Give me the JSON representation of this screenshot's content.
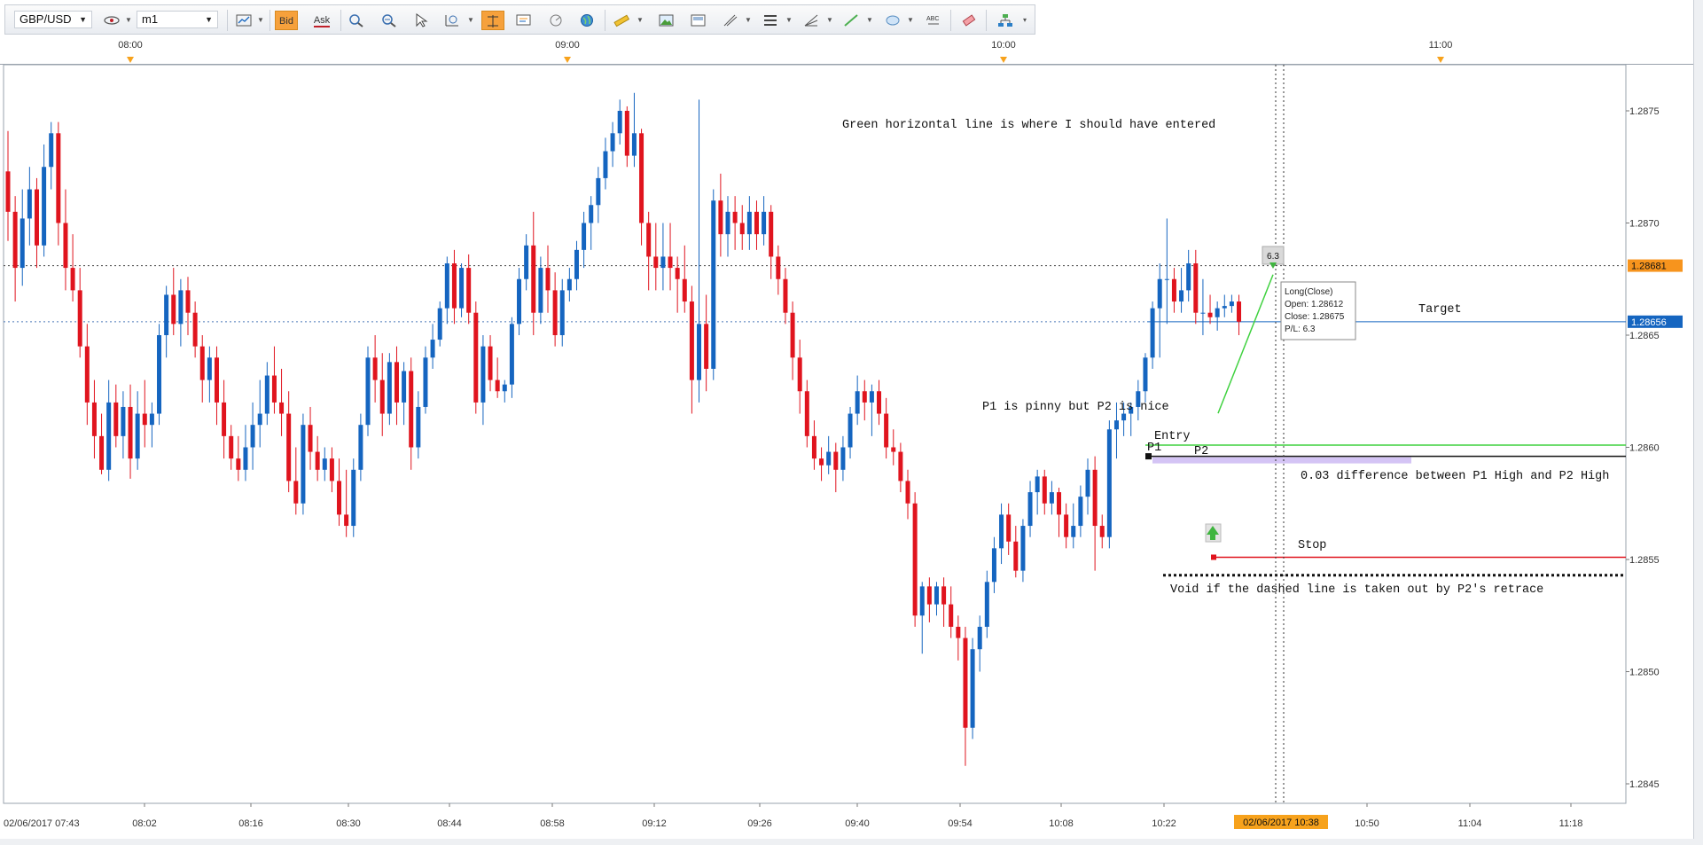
{
  "toolbar": {
    "symbol": "GBP/USD",
    "timeframe": "m1",
    "bid_label": "Bid",
    "ask_label": "Ask"
  },
  "chart_data": {
    "type": "candlestick",
    "symbol": "GBP/USD",
    "timeframe": "m1",
    "time_axis_top": [
      "08:00",
      "09:00",
      "10:00",
      "11:00"
    ],
    "time_axis_bottom": [
      "02/06/2017 07:43",
      "08:02",
      "08:16",
      "08:30",
      "08:44",
      "08:58",
      "09:12",
      "09:26",
      "09:40",
      "09:54",
      "10:08",
      "10:22",
      "10:50",
      "11:04",
      "11:18"
    ],
    "crosshair_time_label": "02/06/2017 10:38",
    "price_ticks": [
      "1.2845",
      "1.2850",
      "1.2855",
      "1.2860",
      "1.2865",
      "1.2870",
      "1.2875"
    ],
    "ylim": [
      1.28435,
      1.2878
    ],
    "price_labels": [
      {
        "value": "1.28681",
        "color": "#f7941d"
      },
      {
        "value": "1.28656",
        "color": "#1565c0"
      }
    ],
    "grid": true,
    "up_color": "#1565c0",
    "down_color": "#e0141e",
    "candles": [
      {
        "o": 1.28723,
        "h": 1.28741,
        "l": 1.28692,
        "c": 1.28705
      },
      {
        "o": 1.28705,
        "h": 1.28712,
        "l": 1.28665,
        "c": 1.2868
      },
      {
        "o": 1.2868,
        "h": 1.28715,
        "l": 1.28672,
        "c": 1.28702
      },
      {
        "o": 1.28702,
        "h": 1.28725,
        "l": 1.2869,
        "c": 1.28715
      },
      {
        "o": 1.28715,
        "h": 1.2872,
        "l": 1.2868,
        "c": 1.2869
      },
      {
        "o": 1.2869,
        "h": 1.28735,
        "l": 1.28685,
        "c": 1.28725
      },
      {
        "o": 1.28725,
        "h": 1.28745,
        "l": 1.28715,
        "c": 1.2874
      },
      {
        "o": 1.2874,
        "h": 1.28745,
        "l": 1.2869,
        "c": 1.287
      },
      {
        "o": 1.287,
        "h": 1.28715,
        "l": 1.2867,
        "c": 1.2868
      },
      {
        "o": 1.2868,
        "h": 1.28695,
        "l": 1.28665,
        "c": 1.2867
      },
      {
        "o": 1.2867,
        "h": 1.2868,
        "l": 1.2864,
        "c": 1.28645
      },
      {
        "o": 1.28645,
        "h": 1.28655,
        "l": 1.2861,
        "c": 1.2862
      },
      {
        "o": 1.2862,
        "h": 1.2863,
        "l": 1.28595,
        "c": 1.28605
      },
      {
        "o": 1.28605,
        "h": 1.28615,
        "l": 1.28588,
        "c": 1.2859
      },
      {
        "o": 1.2859,
        "h": 1.2863,
        "l": 1.28585,
        "c": 1.2862
      },
      {
        "o": 1.2862,
        "h": 1.28628,
        "l": 1.286,
        "c": 1.28605
      },
      {
        "o": 1.28605,
        "h": 1.28625,
        "l": 1.28595,
        "c": 1.28618
      },
      {
        "o": 1.28618,
        "h": 1.28628,
        "l": 1.28586,
        "c": 1.28595
      },
      {
        "o": 1.28595,
        "h": 1.28625,
        "l": 1.2859,
        "c": 1.28615
      },
      {
        "o": 1.28615,
        "h": 1.2863,
        "l": 1.286,
        "c": 1.2861
      },
      {
        "o": 1.2861,
        "h": 1.2862,
        "l": 1.286,
        "c": 1.28615
      },
      {
        "o": 1.28615,
        "h": 1.28655,
        "l": 1.2861,
        "c": 1.2865
      },
      {
        "o": 1.2865,
        "h": 1.28672,
        "l": 1.2864,
        "c": 1.28668
      },
      {
        "o": 1.28668,
        "h": 1.2868,
        "l": 1.2865,
        "c": 1.28655
      },
      {
        "o": 1.28655,
        "h": 1.28675,
        "l": 1.28645,
        "c": 1.2867
      },
      {
        "o": 1.2867,
        "h": 1.28676,
        "l": 1.2865,
        "c": 1.2866
      },
      {
        "o": 1.2866,
        "h": 1.28665,
        "l": 1.2864,
        "c": 1.28645
      },
      {
        "o": 1.28645,
        "h": 1.2865,
        "l": 1.2862,
        "c": 1.2863
      },
      {
        "o": 1.2863,
        "h": 1.28645,
        "l": 1.2862,
        "c": 1.2864
      },
      {
        "o": 1.2864,
        "h": 1.28645,
        "l": 1.2861,
        "c": 1.2862
      },
      {
        "o": 1.2862,
        "h": 1.2863,
        "l": 1.28595,
        "c": 1.28605
      },
      {
        "o": 1.28605,
        "h": 1.2861,
        "l": 1.2859,
        "c": 1.28595
      },
      {
        "o": 1.28595,
        "h": 1.28605,
        "l": 1.28585,
        "c": 1.2859
      },
      {
        "o": 1.2859,
        "h": 1.2861,
        "l": 1.28585,
        "c": 1.286
      },
      {
        "o": 1.286,
        "h": 1.2862,
        "l": 1.2859,
        "c": 1.2861
      },
      {
        "o": 1.2861,
        "h": 1.2863,
        "l": 1.286,
        "c": 1.28615
      },
      {
        "o": 1.28615,
        "h": 1.28638,
        "l": 1.2861,
        "c": 1.28632
      },
      {
        "o": 1.28632,
        "h": 1.28645,
        "l": 1.28615,
        "c": 1.2862
      },
      {
        "o": 1.2862,
        "h": 1.28635,
        "l": 1.28605,
        "c": 1.28615
      },
      {
        "o": 1.28615,
        "h": 1.28625,
        "l": 1.2858,
        "c": 1.28585
      },
      {
        "o": 1.28585,
        "h": 1.286,
        "l": 1.2857,
        "c": 1.28575
      },
      {
        "o": 1.28575,
        "h": 1.28615,
        "l": 1.2857,
        "c": 1.2861
      },
      {
        "o": 1.2861,
        "h": 1.28618,
        "l": 1.2859,
        "c": 1.28598
      },
      {
        "o": 1.28598,
        "h": 1.28605,
        "l": 1.28585,
        "c": 1.2859
      },
      {
        "o": 1.2859,
        "h": 1.286,
        "l": 1.28585,
        "c": 1.28595
      },
      {
        "o": 1.28595,
        "h": 1.286,
        "l": 1.2858,
        "c": 1.28585
      },
      {
        "o": 1.28585,
        "h": 1.28595,
        "l": 1.28565,
        "c": 1.2857
      },
      {
        "o": 1.2857,
        "h": 1.2859,
        "l": 1.2856,
        "c": 1.28565
      },
      {
        "o": 1.28565,
        "h": 1.28595,
        "l": 1.2856,
        "c": 1.2859
      },
      {
        "o": 1.2859,
        "h": 1.28615,
        "l": 1.28585,
        "c": 1.2861
      },
      {
        "o": 1.2861,
        "h": 1.28645,
        "l": 1.28605,
        "c": 1.2864
      },
      {
        "o": 1.2864,
        "h": 1.2865,
        "l": 1.2862,
        "c": 1.2863
      },
      {
        "o": 1.2863,
        "h": 1.28642,
        "l": 1.28605,
        "c": 1.28615
      },
      {
        "o": 1.28615,
        "h": 1.28642,
        "l": 1.2861,
        "c": 1.28638
      },
      {
        "o": 1.28638,
        "h": 1.28645,
        "l": 1.2861,
        "c": 1.2862
      },
      {
        "o": 1.2862,
        "h": 1.28638,
        "l": 1.2861,
        "c": 1.28634
      },
      {
        "o": 1.28634,
        "h": 1.2864,
        "l": 1.2859,
        "c": 1.286
      },
      {
        "o": 1.286,
        "h": 1.28625,
        "l": 1.28595,
        "c": 1.28618
      },
      {
        "o": 1.28618,
        "h": 1.28645,
        "l": 1.28615,
        "c": 1.2864
      },
      {
        "o": 1.2864,
        "h": 1.28655,
        "l": 1.28635,
        "c": 1.28648
      },
      {
        "o": 1.28648,
        "h": 1.28665,
        "l": 1.28645,
        "c": 1.28662
      },
      {
        "o": 1.28662,
        "h": 1.28685,
        "l": 1.28655,
        "c": 1.28682
      },
      {
        "o": 1.28682,
        "h": 1.28688,
        "l": 1.28655,
        "c": 1.28662
      },
      {
        "o": 1.28662,
        "h": 1.28682,
        "l": 1.28658,
        "c": 1.2868
      },
      {
        "o": 1.2868,
        "h": 1.28686,
        "l": 1.28655,
        "c": 1.2866
      },
      {
        "o": 1.2866,
        "h": 1.28665,
        "l": 1.28615,
        "c": 1.2862
      },
      {
        "o": 1.2862,
        "h": 1.2865,
        "l": 1.2861,
        "c": 1.28645
      },
      {
        "o": 1.28645,
        "h": 1.2865,
        "l": 1.28625,
        "c": 1.2863
      },
      {
        "o": 1.2863,
        "h": 1.2864,
        "l": 1.28622,
        "c": 1.28625
      },
      {
        "o": 1.28625,
        "h": 1.2863,
        "l": 1.2862,
        "c": 1.28628
      },
      {
        "o": 1.28628,
        "h": 1.28658,
        "l": 1.28622,
        "c": 1.28655
      },
      {
        "o": 1.28655,
        "h": 1.2868,
        "l": 1.2865,
        "c": 1.28675
      },
      {
        "o": 1.28675,
        "h": 1.28695,
        "l": 1.2867,
        "c": 1.2869
      },
      {
        "o": 1.2869,
        "h": 1.28705,
        "l": 1.2865,
        "c": 1.2866
      },
      {
        "o": 1.2866,
        "h": 1.28685,
        "l": 1.28655,
        "c": 1.2868
      },
      {
        "o": 1.2868,
        "h": 1.2869,
        "l": 1.2866,
        "c": 1.2867
      },
      {
        "o": 1.2867,
        "h": 1.28678,
        "l": 1.28645,
        "c": 1.2865
      },
      {
        "o": 1.2865,
        "h": 1.28675,
        "l": 1.28645,
        "c": 1.2867
      },
      {
        "o": 1.2867,
        "h": 1.2868,
        "l": 1.28665,
        "c": 1.28675
      },
      {
        "o": 1.28675,
        "h": 1.28692,
        "l": 1.2867,
        "c": 1.28688
      },
      {
        "o": 1.28688,
        "h": 1.28705,
        "l": 1.2868,
        "c": 1.287
      },
      {
        "o": 1.287,
        "h": 1.28712,
        "l": 1.28688,
        "c": 1.28708
      },
      {
        "o": 1.28708,
        "h": 1.28725,
        "l": 1.287,
        "c": 1.2872
      },
      {
        "o": 1.2872,
        "h": 1.28738,
        "l": 1.28715,
        "c": 1.28732
      },
      {
        "o": 1.28732,
        "h": 1.28745,
        "l": 1.28725,
        "c": 1.2874
      },
      {
        "o": 1.2874,
        "h": 1.28755,
        "l": 1.28735,
        "c": 1.2875
      },
      {
        "o": 1.2875,
        "h": 1.28752,
        "l": 1.28725,
        "c": 1.2873
      },
      {
        "o": 1.2873,
        "h": 1.28758,
        "l": 1.28725,
        "c": 1.2874
      },
      {
        "o": 1.2874,
        "h": 1.28742,
        "l": 1.2869,
        "c": 1.287
      },
      {
        "o": 1.287,
        "h": 1.28705,
        "l": 1.2867,
        "c": 1.28685
      },
      {
        "o": 1.28685,
        "h": 1.287,
        "l": 1.2867,
        "c": 1.2868
      },
      {
        "o": 1.2868,
        "h": 1.287,
        "l": 1.2867,
        "c": 1.28685
      },
      {
        "o": 1.28685,
        "h": 1.287,
        "l": 1.2867,
        "c": 1.2868
      },
      {
        "o": 1.2868,
        "h": 1.28685,
        "l": 1.2866,
        "c": 1.28675
      },
      {
        "o": 1.28675,
        "h": 1.2869,
        "l": 1.2866,
        "c": 1.28665
      },
      {
        "o": 1.28665,
        "h": 1.28672,
        "l": 1.28615,
        "c": 1.2863
      },
      {
        "o": 1.2863,
        "h": 1.28755,
        "l": 1.2862,
        "c": 1.28655
      },
      {
        "o": 1.28655,
        "h": 1.28668,
        "l": 1.28625,
        "c": 1.28635
      },
      {
        "o": 1.28635,
        "h": 1.28715,
        "l": 1.2863,
        "c": 1.2871
      },
      {
        "o": 1.2871,
        "h": 1.28722,
        "l": 1.28685,
        "c": 1.28695
      },
      {
        "o": 1.28695,
        "h": 1.28712,
        "l": 1.28685,
        "c": 1.28705
      },
      {
        "o": 1.28705,
        "h": 1.28712,
        "l": 1.28688,
        "c": 1.287
      },
      {
        "o": 1.287,
        "h": 1.28708,
        "l": 1.28688,
        "c": 1.28695
      },
      {
        "o": 1.28695,
        "h": 1.28712,
        "l": 1.28688,
        "c": 1.28705
      },
      {
        "o": 1.28705,
        "h": 1.2871,
        "l": 1.28688,
        "c": 1.28695
      },
      {
        "o": 1.28695,
        "h": 1.28712,
        "l": 1.2869,
        "c": 1.28705
      },
      {
        "o": 1.28705,
        "h": 1.28708,
        "l": 1.28675,
        "c": 1.28685
      },
      {
        "o": 1.28685,
        "h": 1.2869,
        "l": 1.28668,
        "c": 1.28675
      },
      {
        "o": 1.28675,
        "h": 1.2868,
        "l": 1.28655,
        "c": 1.2866
      },
      {
        "o": 1.2866,
        "h": 1.28665,
        "l": 1.2863,
        "c": 1.2864
      },
      {
        "o": 1.2864,
        "h": 1.28648,
        "l": 1.28615,
        "c": 1.28625
      },
      {
        "o": 1.28625,
        "h": 1.2863,
        "l": 1.286,
        "c": 1.28605
      },
      {
        "o": 1.28605,
        "h": 1.28612,
        "l": 1.2859,
        "c": 1.28595
      },
      {
        "o": 1.28595,
        "h": 1.286,
        "l": 1.28585,
        "c": 1.28592
      },
      {
        "o": 1.28592,
        "h": 1.28605,
        "l": 1.28588,
        "c": 1.28598
      },
      {
        "o": 1.28598,
        "h": 1.28602,
        "l": 1.2858,
        "c": 1.2859
      },
      {
        "o": 1.2859,
        "h": 1.28605,
        "l": 1.28585,
        "c": 1.286
      },
      {
        "o": 1.286,
        "h": 1.28618,
        "l": 1.28595,
        "c": 1.28615
      },
      {
        "o": 1.28615,
        "h": 1.28632,
        "l": 1.2861,
        "c": 1.28625
      },
      {
        "o": 1.28625,
        "h": 1.2863,
        "l": 1.28612,
        "c": 1.2862
      },
      {
        "o": 1.2862,
        "h": 1.28628,
        "l": 1.28605,
        "c": 1.28625
      },
      {
        "o": 1.28625,
        "h": 1.2863,
        "l": 1.2861,
        "c": 1.28615
      },
      {
        "o": 1.28615,
        "h": 1.28622,
        "l": 1.28595,
        "c": 1.286
      },
      {
        "o": 1.286,
        "h": 1.28608,
        "l": 1.28592,
        "c": 1.28598
      },
      {
        "o": 1.28598,
        "h": 1.28602,
        "l": 1.2858,
        "c": 1.28585
      },
      {
        "o": 1.28585,
        "h": 1.2859,
        "l": 1.28568,
        "c": 1.28575
      },
      {
        "o": 1.28575,
        "h": 1.2858,
        "l": 1.2852,
        "c": 1.28525
      },
      {
        "o": 1.28525,
        "h": 1.2854,
        "l": 1.28508,
        "c": 1.28538
      },
      {
        "o": 1.28538,
        "h": 1.28542,
        "l": 1.28522,
        "c": 1.2853
      },
      {
        "o": 1.2853,
        "h": 1.2854,
        "l": 1.28525,
        "c": 1.28538
      },
      {
        "o": 1.28538,
        "h": 1.28542,
        "l": 1.2852,
        "c": 1.2853
      },
      {
        "o": 1.2853,
        "h": 1.28538,
        "l": 1.28515,
        "c": 1.2852
      },
      {
        "o": 1.2852,
        "h": 1.28525,
        "l": 1.28505,
        "c": 1.28515
      },
      {
        "o": 1.28515,
        "h": 1.2852,
        "l": 1.28458,
        "c": 1.28475
      },
      {
        "o": 1.28475,
        "h": 1.28515,
        "l": 1.2847,
        "c": 1.2851
      },
      {
        "o": 1.2851,
        "h": 1.28525,
        "l": 1.285,
        "c": 1.2852
      },
      {
        "o": 1.2852,
        "h": 1.28545,
        "l": 1.28515,
        "c": 1.2854
      },
      {
        "o": 1.2854,
        "h": 1.2856,
        "l": 1.28535,
        "c": 1.28555
      },
      {
        "o": 1.28555,
        "h": 1.28575,
        "l": 1.28548,
        "c": 1.2857
      },
      {
        "o": 1.2857,
        "h": 1.28575,
        "l": 1.28552,
        "c": 1.28558
      },
      {
        "o": 1.28558,
        "h": 1.28565,
        "l": 1.28542,
        "c": 1.28545
      },
      {
        "o": 1.28545,
        "h": 1.28568,
        "l": 1.2854,
        "c": 1.28565
      },
      {
        "o": 1.28565,
        "h": 1.28585,
        "l": 1.2856,
        "c": 1.2858
      },
      {
        "o": 1.2858,
        "h": 1.2859,
        "l": 1.2857,
        "c": 1.28587
      },
      {
        "o": 1.28587,
        "h": 1.2859,
        "l": 1.2857,
        "c": 1.28575
      },
      {
        "o": 1.28575,
        "h": 1.28585,
        "l": 1.2857,
        "c": 1.2858
      },
      {
        "o": 1.2858,
        "h": 1.28582,
        "l": 1.2856,
        "c": 1.2857
      },
      {
        "o": 1.2857,
        "h": 1.28575,
        "l": 1.28555,
        "c": 1.2856
      },
      {
        "o": 1.2856,
        "h": 1.28575,
        "l": 1.28555,
        "c": 1.28565
      },
      {
        "o": 1.28565,
        "h": 1.28583,
        "l": 1.2856,
        "c": 1.28578
      },
      {
        "o": 1.28578,
        "h": 1.28595,
        "l": 1.2857,
        "c": 1.2859
      },
      {
        "o": 1.2859,
        "h": 1.28596,
        "l": 1.28545,
        "c": 1.28565
      },
      {
        "o": 1.28565,
        "h": 1.2857,
        "l": 1.28555,
        "c": 1.2856
      },
      {
        "o": 1.2856,
        "h": 1.28612,
        "l": 1.28555,
        "c": 1.28608
      },
      {
        "o": 1.28608,
        "h": 1.2862,
        "l": 1.28595,
        "c": 1.28612
      },
      {
        "o": 1.28612,
        "h": 1.2862,
        "l": 1.28605,
        "c": 1.28615
      },
      {
        "o": 1.28615,
        "h": 1.2862,
        "l": 1.28605,
        "c": 1.28618
      },
      {
        "o": 1.28618,
        "h": 1.2863,
        "l": 1.28612,
        "c": 1.28625
      },
      {
        "o": 1.28625,
        "h": 1.28642,
        "l": 1.2862,
        "c": 1.2864
      },
      {
        "o": 1.2864,
        "h": 1.28665,
        "l": 1.28635,
        "c": 1.28662
      },
      {
        "o": 1.28662,
        "h": 1.28682,
        "l": 1.2864,
        "c": 1.28675
      },
      {
        "o": 1.28675,
        "h": 1.28702,
        "l": 1.28655,
        "c": 1.28675
      },
      {
        "o": 1.28675,
        "h": 1.2868,
        "l": 1.2866,
        "c": 1.28665
      },
      {
        "o": 1.28665,
        "h": 1.2868,
        "l": 1.2866,
        "c": 1.2867
      },
      {
        "o": 1.2867,
        "h": 1.28688,
        "l": 1.28665,
        "c": 1.28682
      },
      {
        "o": 1.28682,
        "h": 1.28688,
        "l": 1.28655,
        "c": 1.2866
      },
      {
        "o": 1.2866,
        "h": 1.28675,
        "l": 1.2865,
        "c": 1.2866
      },
      {
        "o": 1.2866,
        "h": 1.28668,
        "l": 1.28655,
        "c": 1.28658
      },
      {
        "o": 1.28658,
        "h": 1.28665,
        "l": 1.28652,
        "c": 1.28662
      },
      {
        "o": 1.28662,
        "h": 1.28668,
        "l": 1.28658,
        "c": 1.28663
      },
      {
        "o": 1.28663,
        "h": 1.28668,
        "l": 1.2866,
        "c": 1.28665
      },
      {
        "o": 1.28665,
        "h": 1.28668,
        "l": 1.2865,
        "c": 1.28656
      }
    ],
    "annotations": {
      "green_line_note": "Green horizontal line is where I should have entered",
      "pinny_note": "P1 is pinny but P2 is nice",
      "entry_label": "Entry",
      "p1_label": "P1",
      "p2_label": "P2",
      "difference_note": "0.03 difference between P1 High and P2 High",
      "stop_label": "Stop",
      "void_note": "Void if the dashed line is taken out by P2's retrace",
      "target_label": "Target"
    },
    "levels": {
      "dotted_level": 1.28681,
      "target": 1.28656,
      "green_entry": 1.28601,
      "entry": 1.28596,
      "stop": 1.28551,
      "void_dashed": 1.28543
    },
    "trade": {
      "pnl_badge": "6.3",
      "tooltip": [
        "Long(Close)",
        "Open: 1.28612",
        "Close: 1.28675",
        "P/L: 6.3"
      ],
      "open": 1.28612,
      "close": 1.28675
    }
  }
}
